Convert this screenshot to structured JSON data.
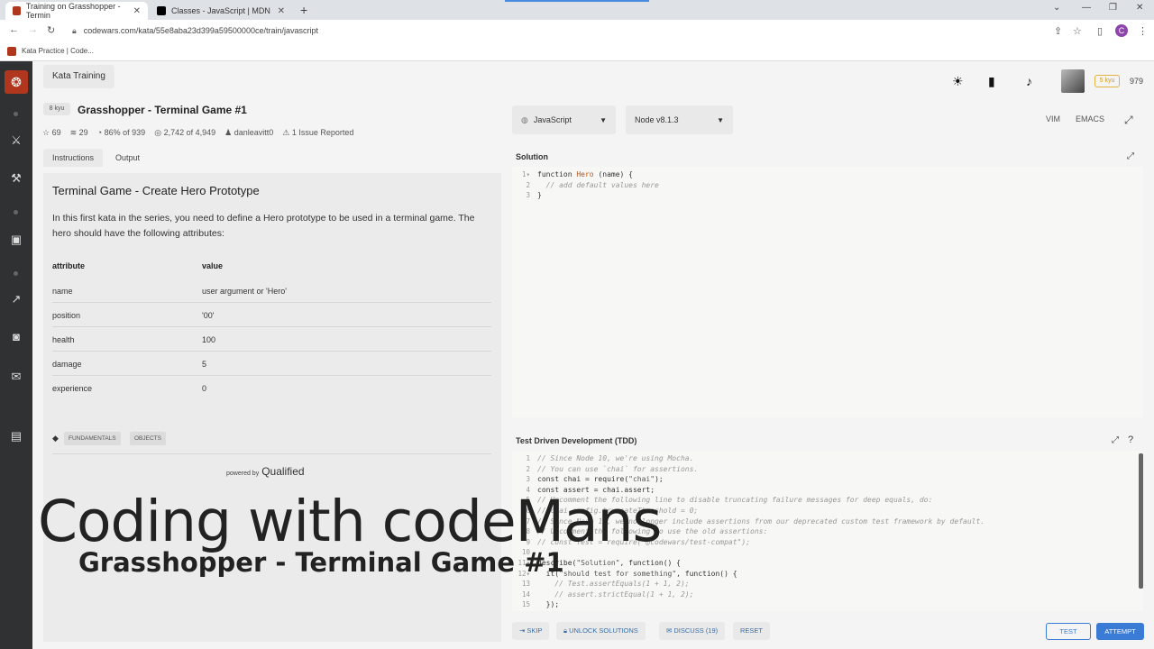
{
  "browser": {
    "tabs": [
      {
        "title": "Training on Grasshopper - Termin",
        "close": "✕"
      },
      {
        "title": "Classes - JavaScript | MDN",
        "close": "✕"
      }
    ],
    "new_tab": "+",
    "url": "codewars.com/kata/55e8aba23d399a59500000ce/train/javascript",
    "bookmark": "Kata Practice | Code...",
    "profile_initial": "C"
  },
  "header": {
    "kata_training": "Kata Training",
    "kyu_badge": "5 kyu",
    "honor": "979"
  },
  "kata": {
    "kyu": "8 kyu",
    "title": "Grasshopper - Terminal Game #1",
    "stats": {
      "stars": "69",
      "collections": "29",
      "satisfaction": "86% of 939",
      "completed": "2,742 of 4,949",
      "author": "danleavitt0",
      "issues": "1 Issue Reported"
    }
  },
  "left_tabs": {
    "instructions": "Instructions",
    "output": "Output"
  },
  "instructions": {
    "title": "Terminal Game - Create Hero Prototype",
    "paragraph": "In this first kata in the series, you need to define a Hero prototype to be used in a terminal game. The hero should have the following attributes:",
    "col_attribute": "attribute",
    "col_value": "value",
    "rows": [
      {
        "k": "name",
        "v": "user argument or 'Hero'"
      },
      {
        "k": "position",
        "v": "'00'"
      },
      {
        "k": "health",
        "v": "100"
      },
      {
        "k": "damage",
        "v": "5"
      },
      {
        "k": "experience",
        "v": "0"
      }
    ],
    "tags": [
      "FUNDAMENTALS",
      "OBJECTS"
    ],
    "powered_by": "powered by",
    "qualified": "Qualified"
  },
  "editor": {
    "language": "JavaScript",
    "runtime": "Node v8.1.3",
    "vim": "VIM",
    "emacs": "EMACS",
    "solution_label": "Solution",
    "tdd_label": "Test Driven Development (TDD)"
  },
  "actions": {
    "skip": "SKIP",
    "unlock": "UNLOCK SOLUTIONS",
    "discuss": "DISCUSS (19)",
    "reset": "RESET",
    "test": "TEST",
    "attempt": "ATTEMPT"
  },
  "overlay": {
    "line1": "Coding with codeMans",
    "line2": "Grasshopper - Terminal Game #1"
  }
}
